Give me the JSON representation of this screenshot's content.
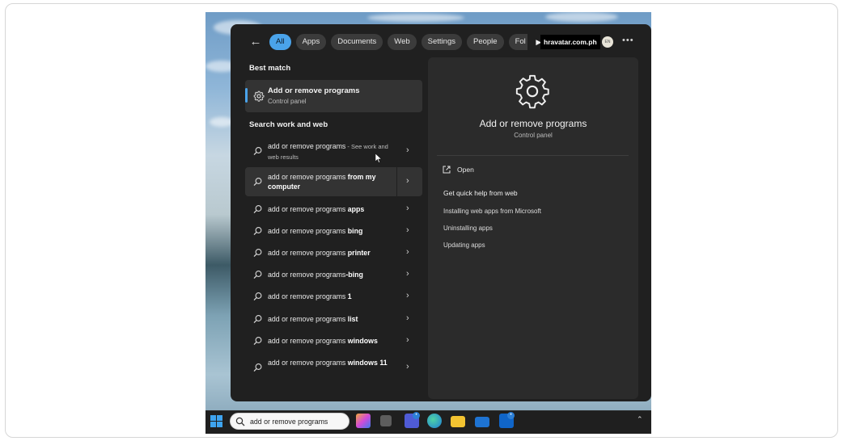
{
  "filters": {
    "items": [
      "All",
      "Apps",
      "Documents",
      "Web",
      "Settings",
      "People",
      "Fol"
    ],
    "active": "All"
  },
  "account": {
    "label": "hravatar.com.ph",
    "avatar_text": "EN"
  },
  "best_match": {
    "heading": "Best match",
    "title": "Add or remove programs",
    "subtitle": "Control panel"
  },
  "web": {
    "heading": "Search work and web",
    "results": [
      {
        "base": "add or remove programs",
        "bold": "",
        "suffix": " - See work and web results"
      },
      {
        "base": "add or remove programs ",
        "bold": "from my computer",
        "suffix": ""
      },
      {
        "base": "add or remove programs ",
        "bold": "apps",
        "suffix": ""
      },
      {
        "base": "add or remove programs ",
        "bold": "bing",
        "suffix": ""
      },
      {
        "base": "add or remove programs ",
        "bold": "printer",
        "suffix": ""
      },
      {
        "base": "add or remove programs",
        "bold": "-bing",
        "suffix": ""
      },
      {
        "base": "add or remove programs ",
        "bold": "1",
        "suffix": ""
      },
      {
        "base": "add or remove programs ",
        "bold": "list",
        "suffix": ""
      },
      {
        "base": "add or remove programs ",
        "bold": "windows",
        "suffix": ""
      },
      {
        "base": "add or remove programs ",
        "bold": "windows 11",
        "suffix": ""
      }
    ]
  },
  "detail": {
    "title": "Add or remove programs",
    "subtitle": "Control panel",
    "open_label": "Open",
    "help_heading": "Get quick help from web",
    "help_links": [
      "Installing web apps from Microsoft",
      "Uninstalling apps",
      "Updating apps"
    ]
  },
  "taskbar": {
    "search_value": "add or remove programs",
    "icons": [
      "copilot-icon",
      "task-view-icon",
      "teams-icon",
      "edge-icon",
      "file-explorer-icon",
      "mail-icon",
      "outlook-icon"
    ]
  },
  "colors": {
    "accent": "#4aa3ea",
    "panel": "#202020",
    "detail": "#2b2b2b"
  }
}
